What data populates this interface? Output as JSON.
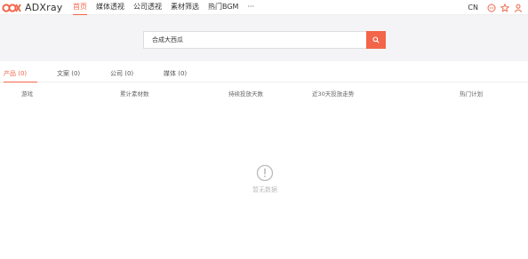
{
  "app": {
    "brand": "ADXray",
    "brand_color": "#f2654a"
  },
  "nav": {
    "items": [
      {
        "label": "首页",
        "active": true
      },
      {
        "label": "媒体透视",
        "active": false
      },
      {
        "label": "公司透视",
        "active": false
      },
      {
        "label": "素材筛选",
        "active": false
      },
      {
        "label": "热门BGM",
        "active": false
      },
      {
        "label": "···",
        "active": false
      }
    ],
    "lang": "CN",
    "icons": [
      "message-icon",
      "star-icon",
      "user-icon"
    ]
  },
  "search": {
    "value": "合成大西瓜",
    "button_icon": "search-icon"
  },
  "tabs": [
    {
      "label": "产品",
      "count": "(0)",
      "active": true
    },
    {
      "label": "文案",
      "count": "(0)",
      "active": false
    },
    {
      "label": "公司",
      "count": "(0)",
      "active": false
    },
    {
      "label": "媒体",
      "count": "(0)",
      "active": false
    }
  ],
  "table": {
    "columns": [
      "游戏",
      "累计素材数",
      "持续投放天数",
      "近30天投放走势",
      "热门计划"
    ]
  },
  "empty": {
    "icon": "info-circle-icon",
    "text": "暂无数据"
  }
}
